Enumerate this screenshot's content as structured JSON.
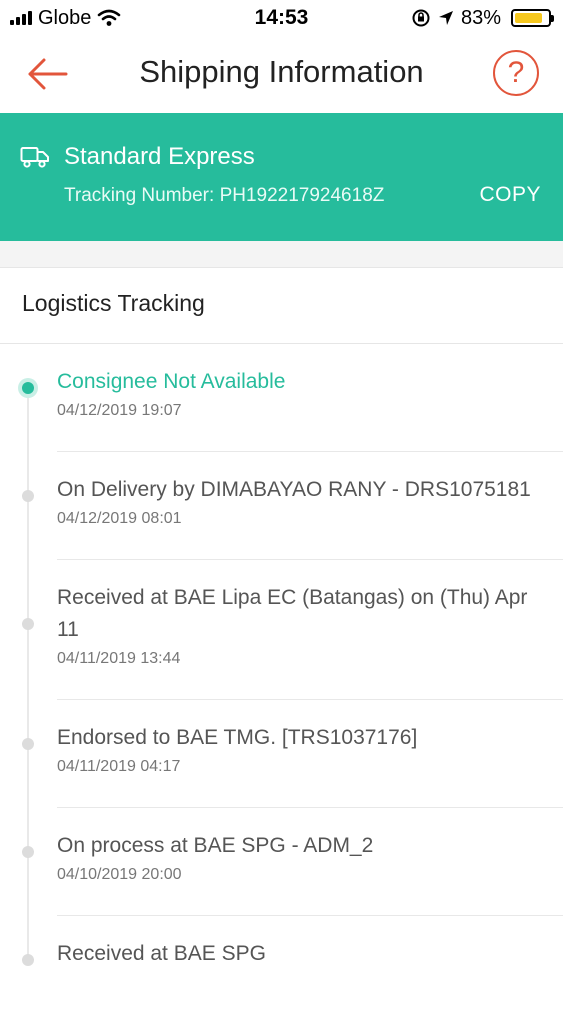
{
  "status_bar": {
    "carrier": "Globe",
    "time": "14:53",
    "battery": "83%",
    "battery_level": 0.83,
    "icons": [
      "signal-icon",
      "wifi-icon",
      "rotation-lock-icon",
      "location-arrow-icon",
      "battery-icon"
    ]
  },
  "header": {
    "title": "Shipping Information",
    "back_icon": "back-arrow-icon",
    "help_label": "?"
  },
  "colors": {
    "accent": "#26bc9c",
    "header_icon": "#e2553b",
    "battery": "#f6c81f"
  },
  "shipment": {
    "service": "Standard Express",
    "tracking_label": "Tracking Number: PH192217924618Z",
    "copy_label": "COPY",
    "icon": "truck-icon"
  },
  "logistics": {
    "title": "Logistics Tracking",
    "events": [
      {
        "status": "Consignee Not Available",
        "time": "04/12/2019 19:07",
        "active": true
      },
      {
        "status": "On Delivery by DIMABAYAO RANY - DRS1075181",
        "time": "04/12/2019 08:01",
        "active": false
      },
      {
        "status": "Received at BAE Lipa EC (Batangas) on (Thu) Apr 11",
        "time": "04/11/2019 13:44",
        "active": false
      },
      {
        "status": "Endorsed to BAE TMG. [TRS1037176]",
        "time": "04/11/2019 04:17",
        "active": false
      },
      {
        "status": "On process at BAE SPG - ADM_2",
        "time": "04/10/2019 20:00",
        "active": false
      },
      {
        "status": "Received at BAE SPG",
        "time": "",
        "active": false
      }
    ]
  }
}
